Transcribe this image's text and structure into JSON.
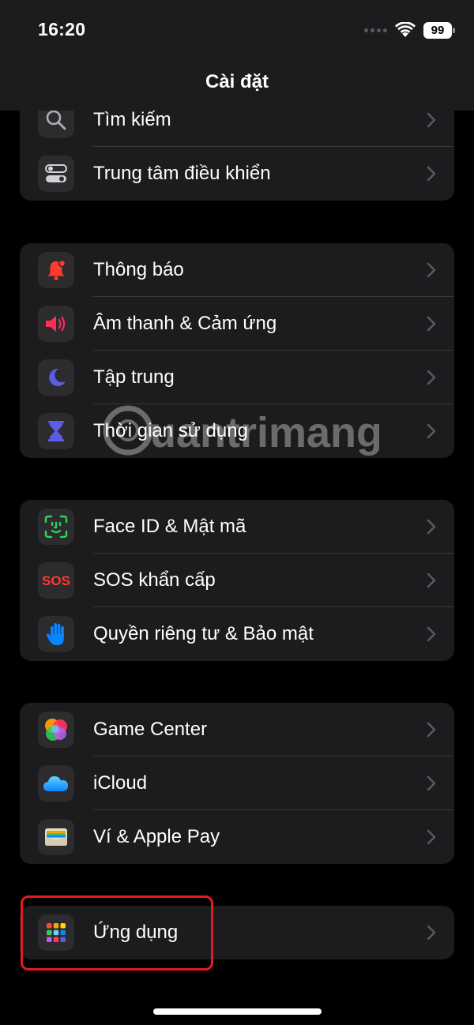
{
  "status_bar": {
    "time": "16:20",
    "battery": "99"
  },
  "nav": {
    "title": "Cài đặt"
  },
  "groups": [
    {
      "items": [
        {
          "label": "Tìm kiếm",
          "icon": "search-icon"
        },
        {
          "label": "Trung tâm điều khiển",
          "icon": "control-center-icon"
        }
      ]
    },
    {
      "items": [
        {
          "label": "Thông báo",
          "icon": "notification-bell-icon"
        },
        {
          "label": "Âm thanh & Cảm ứng",
          "icon": "speaker-icon"
        },
        {
          "label": "Tập trung",
          "icon": "moon-icon"
        },
        {
          "label": "Thời gian sử dụng",
          "icon": "hourglass-icon"
        }
      ]
    },
    {
      "items": [
        {
          "label": "Face ID & Mật mã",
          "icon": "face-id-icon"
        },
        {
          "label": "SOS khẩn cấp",
          "icon": "sos-icon"
        },
        {
          "label": "Quyền riêng tư & Bảo mật",
          "icon": "privacy-hand-icon"
        }
      ]
    },
    {
      "items": [
        {
          "label": "Game Center",
          "icon": "game-center-icon"
        },
        {
          "label": "iCloud",
          "icon": "icloud-icon"
        },
        {
          "label": "Ví & Apple Pay",
          "icon": "wallet-icon"
        }
      ]
    },
    {
      "items": [
        {
          "label": "Ứng dụng",
          "icon": "apps-grid-icon"
        }
      ]
    }
  ],
  "watermark": {
    "text": "uantrimang"
  },
  "colors": {
    "background": "#000000",
    "cell": "#1c1c1e",
    "separator": "#38383a",
    "chevron": "#5a5a5e",
    "highlight": "#e21b23"
  }
}
